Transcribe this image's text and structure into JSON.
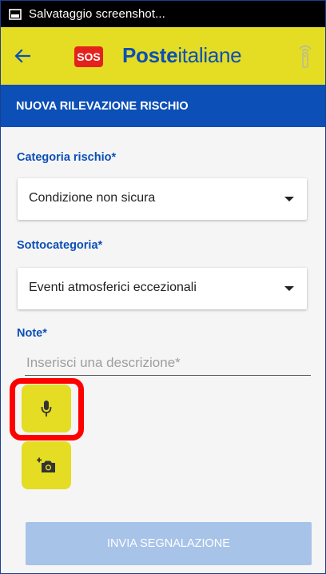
{
  "status_bar": {
    "notification_icon": "screenshot-icon",
    "text": "Salvataggio screenshot..."
  },
  "app_bar": {
    "back_icon": "arrow-back-icon",
    "sos_label": "SOS",
    "brand_bold": "Poste",
    "brand_regular": "italiane",
    "signal_icon": "signal-remote-icon",
    "background_color": "#e4dd23"
  },
  "title_bar": {
    "title": "NUOVA RILEVAZIONE RISCHIO",
    "background_color": "#0c4fb6"
  },
  "form": {
    "category_label": "Categoria rischio*",
    "category_value": "Condizione non sicura",
    "subcategory_label": "Sottocategoria*",
    "subcategory_value": "Eventi atmosferici eccezionali",
    "note_label": "Note*",
    "note_placeholder": "Inserisci una descrizione*",
    "mic_icon": "microphone-icon",
    "camera_icon": "add-photo-camera-icon",
    "submit_label": "INVIA SEGNALAZIONE"
  },
  "colors": {
    "accent_blue": "#0c4fb6",
    "accent_yellow": "#e4dd23",
    "highlight_red": "#ff0000",
    "disabled_button": "#a7c3e8"
  }
}
